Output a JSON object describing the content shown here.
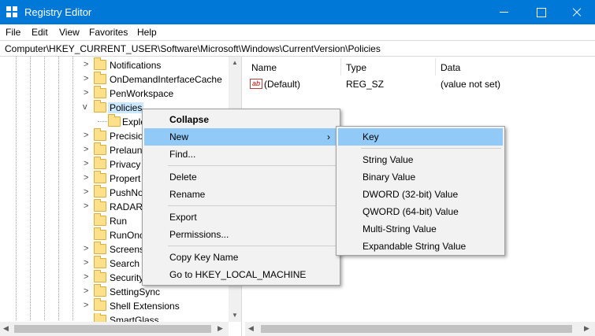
{
  "window": {
    "title": "Registry Editor"
  },
  "menubar": [
    "File",
    "Edit",
    "View",
    "Favorites",
    "Help"
  ],
  "address": "Computer\\HKEY_CURRENT_USER\\Software\\Microsoft\\Windows\\CurrentVersion\\Policies",
  "tree": {
    "items": [
      {
        "label": "Notifications",
        "expander": ">"
      },
      {
        "label": "OnDemandInterfaceCache",
        "expander": ">"
      },
      {
        "label": "PenWorkspace",
        "expander": ">"
      },
      {
        "label": "Policies",
        "expander": "v"
      },
      {
        "label": "Explo"
      },
      {
        "label": "Precisio",
        "expander": ">"
      },
      {
        "label": "Prelaun",
        "expander": ">"
      },
      {
        "label": "Privacy",
        "expander": ">"
      },
      {
        "label": "Propert",
        "expander": ">"
      },
      {
        "label": "PushNo",
        "expander": ">"
      },
      {
        "label": "RADAR",
        "expander": ">"
      },
      {
        "label": "Run"
      },
      {
        "label": "RunOnc"
      },
      {
        "label": "Screens",
        "expander": ">"
      },
      {
        "label": "Search",
        "expander": ">"
      },
      {
        "label": "Security",
        "expander": ">"
      },
      {
        "label": "SettingSync",
        "expander": ">"
      },
      {
        "label": "Shell Extensions",
        "expander": ">"
      },
      {
        "label": "SmartGlass"
      }
    ]
  },
  "values": {
    "columns": [
      "Name",
      "Type",
      "Data"
    ],
    "rows": [
      {
        "icon": "ab",
        "name": "(Default)",
        "type": "REG_SZ",
        "data": "(value not set)"
      }
    ]
  },
  "context_menu": {
    "items": [
      "Collapse",
      "New",
      "Find...",
      "Delete",
      "Rename",
      "Export",
      "Permissions...",
      "Copy Key Name",
      "Go to HKEY_LOCAL_MACHINE"
    ],
    "submenu_arrow": "›"
  },
  "submenu": {
    "items": [
      "Key",
      "String Value",
      "Binary Value",
      "DWORD (32-bit) Value",
      "QWORD (64-bit) Value",
      "Multi-String Value",
      "Expandable String Value"
    ]
  },
  "colors": {
    "titlebar": "#0078d7",
    "highlight": "#91c9f7",
    "selection": "#cce8ff"
  }
}
